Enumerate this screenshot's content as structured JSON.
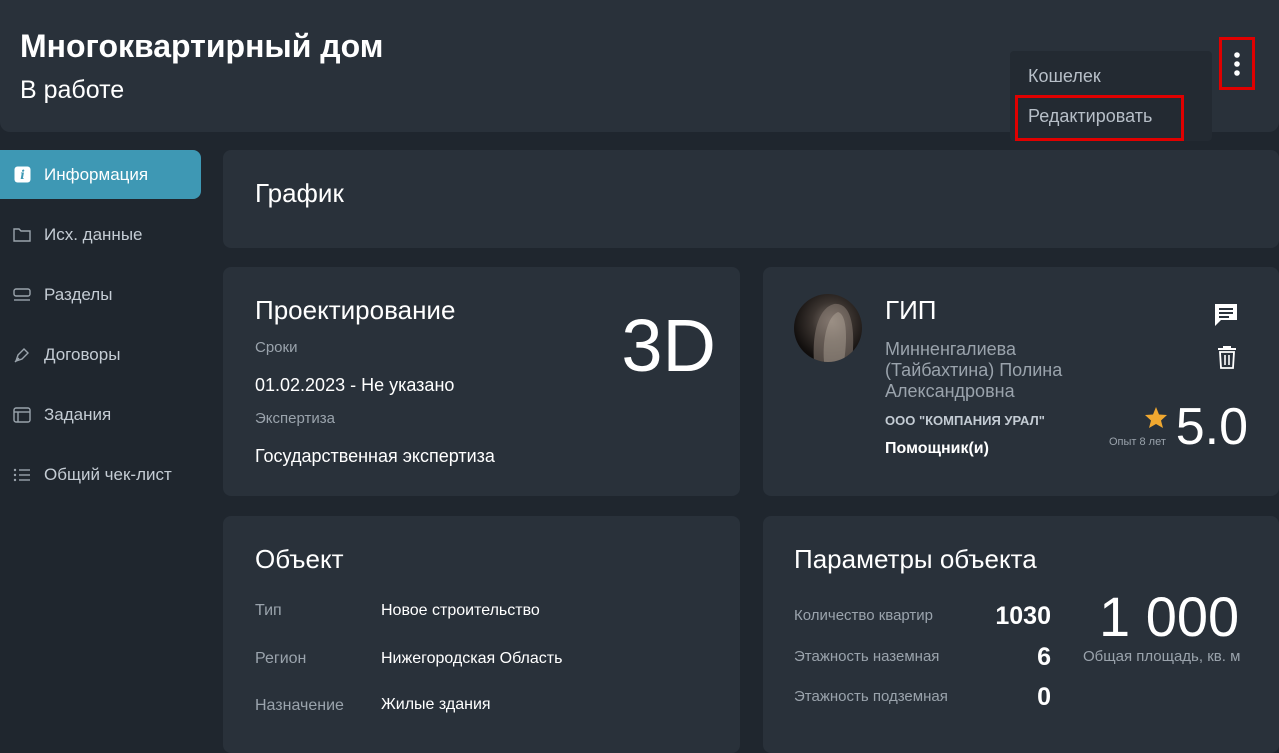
{
  "header": {
    "title": "Многоквартирный дом",
    "status": "В работе",
    "menu": {
      "wallet": "Кошелек",
      "edit": "Редактировать"
    }
  },
  "sidebar": {
    "items": [
      {
        "label": "Информация",
        "icon": "info-icon"
      },
      {
        "label": "Исх. данные",
        "icon": "folder-icon"
      },
      {
        "label": "Разделы",
        "icon": "sections-icon"
      },
      {
        "label": "Договоры",
        "icon": "pen-icon"
      },
      {
        "label": "Задания",
        "icon": "tasks-icon"
      },
      {
        "label": "Общий чек-лист",
        "icon": "list-icon"
      }
    ]
  },
  "schedule": {
    "title": "График"
  },
  "design": {
    "title": "Проектирование",
    "terms_label": "Сроки",
    "terms_value": "01.02.2023 - Не указано",
    "expertise_label": "Экспертиза",
    "expertise_value": "Государственная экспертиза",
    "badge": "3D"
  },
  "gip": {
    "title": "ГИП",
    "name": "Минненгалиева (Тайбахтина) Полина Александровна",
    "company": "ООО \"КОМПАНИЯ УРАЛ\"",
    "assistants": "Помощник(и)",
    "experience": "Опыт 8 лет",
    "rating": "5.0",
    "accent": "#f0a830"
  },
  "object": {
    "title": "Объект",
    "rows": [
      {
        "label": "Тип",
        "value": "Новое строительство"
      },
      {
        "label": "Регион",
        "value": "Нижегородская Область"
      },
      {
        "label": "Назначение",
        "value": "Жилые здания"
      }
    ]
  },
  "params": {
    "title": "Параметры объекта",
    "rows": [
      {
        "label": "Количество квартир",
        "value": "1030"
      },
      {
        "label": "Этажность наземная",
        "value": "6"
      },
      {
        "label": "Этажность подземная",
        "value": "0"
      }
    ],
    "area_value": "1 000",
    "area_label": "Общая площадь, кв. м"
  },
  "colors": {
    "bg": "#1f262e",
    "card": "#29313a",
    "active": "#3e98b4",
    "highlight": "#e00000"
  }
}
